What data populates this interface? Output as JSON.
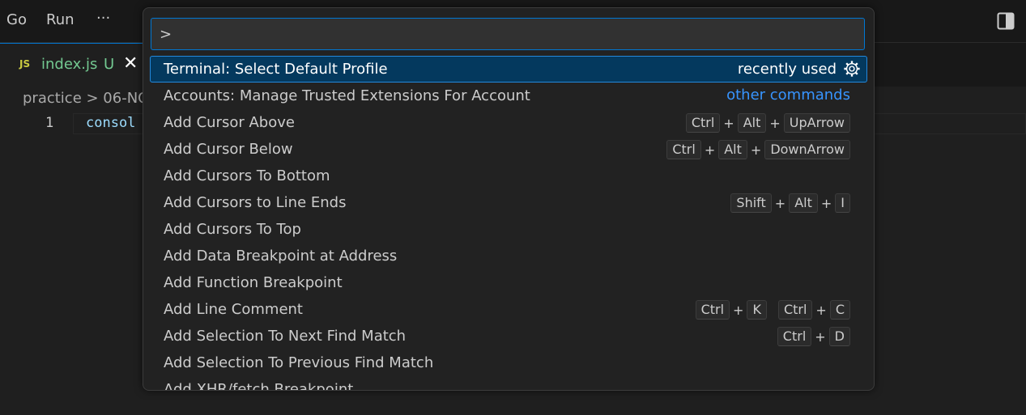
{
  "menubar": {
    "items": [
      "Go",
      "Run",
      "···"
    ]
  },
  "tab": {
    "lang_badge": "JS",
    "filename": "index.js",
    "status": "U",
    "close": "✕"
  },
  "breadcrumb": {
    "text": "practice  >  06-NO"
  },
  "editor": {
    "line_number": "1",
    "code": "consol"
  },
  "palette": {
    "input_value": ">",
    "items": [
      {
        "label": "Terminal: Select Default Profile",
        "tag": "recently used",
        "selected": true,
        "keys": []
      },
      {
        "label": "Accounts: Manage Trusted Extensions For Account",
        "tag": "other commands",
        "keys": []
      },
      {
        "label": "Add Cursor Above",
        "keys": [
          [
            "Ctrl",
            "Alt",
            "UpArrow"
          ]
        ]
      },
      {
        "label": "Add Cursor Below",
        "keys": [
          [
            "Ctrl",
            "Alt",
            "DownArrow"
          ]
        ]
      },
      {
        "label": "Add Cursors To Bottom",
        "keys": []
      },
      {
        "label": "Add Cursors to Line Ends",
        "keys": [
          [
            "Shift",
            "Alt",
            "I"
          ]
        ]
      },
      {
        "label": "Add Cursors To Top",
        "keys": []
      },
      {
        "label": "Add Data Breakpoint at Address",
        "keys": []
      },
      {
        "label": "Add Function Breakpoint",
        "keys": []
      },
      {
        "label": "Add Line Comment",
        "keys": [
          [
            "Ctrl",
            "K"
          ],
          [
            "Ctrl",
            "C"
          ]
        ]
      },
      {
        "label": "Add Selection To Next Find Match",
        "keys": [
          [
            "Ctrl",
            "D"
          ]
        ]
      },
      {
        "label": "Add Selection To Previous Find Match",
        "keys": []
      },
      {
        "label": "Add XHR/fetch Breakpoint",
        "keys": []
      }
    ]
  },
  "colors": {
    "accent": "#0078d4",
    "selected_bg": "#04395e",
    "link": "#3794ff",
    "untracked": "#73c991"
  }
}
